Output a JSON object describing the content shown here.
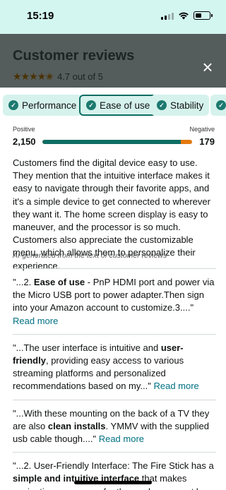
{
  "status_bar": {
    "time": "15:19",
    "icons": [
      "signal-icon",
      "wifi-icon",
      "battery-icon"
    ]
  },
  "header": {
    "title": "Customer reviews",
    "rating_stars": "★★★★✬",
    "rating_text": "4.7 out of 5",
    "close_icon": "×"
  },
  "chips": [
    {
      "label": "Performance",
      "selected": false
    },
    {
      "label": "Ease of use",
      "selected": true
    },
    {
      "label": "Stability",
      "selected": false
    },
    {
      "label": "",
      "selected": false
    }
  ],
  "sentiment": {
    "positive_label": "Positive",
    "negative_label": "Negative",
    "positive_count": "2,150",
    "negative_count": "179",
    "positive_fraction": 0.923,
    "colors": {
      "positive": "#0f6e64",
      "negative": "#e47911"
    }
  },
  "summary": {
    "text": "Customers find the digital device easy to use. They mention that the intuitive interface makes it easy to navigate through their favorite apps, and it's a simple device to get connected to wherever they want it. The home screen display is easy to maneuver, and the processor is so much. Customers also appreciate the customizable menu, which allows them to personalize their experience.",
    "ai_note": "AI-generated from the text of customer reviews"
  },
  "quotes": [
    {
      "before": "\"...2. ",
      "highlight": "Ease of use",
      "after": " - PnP HDMI port and power via the Micro USB port to power adapter.Then sign into your Amazon account to customize.3....\" ",
      "more": "Read more"
    },
    {
      "before": "\"...The user interface is intuitive and ",
      "highlight": "user-friendly",
      "after": ", providing easy access to various streaming platforms and personalized recommendations based on my...\" ",
      "more": "Read more"
    },
    {
      "before": "\"...With these mounting on the back of a TV they are also ",
      "highlight": "clean installs",
      "after": ". YMMV with the supplied usb cable though....\" ",
      "more": "Read more"
    },
    {
      "before": "\"...2. User-Friendly Interface: The Fire Stick has a ",
      "highlight": "simple and intuitive interface",
      "after": " that makes navigation easy, even for those who may not be",
      "more": ""
    }
  ]
}
